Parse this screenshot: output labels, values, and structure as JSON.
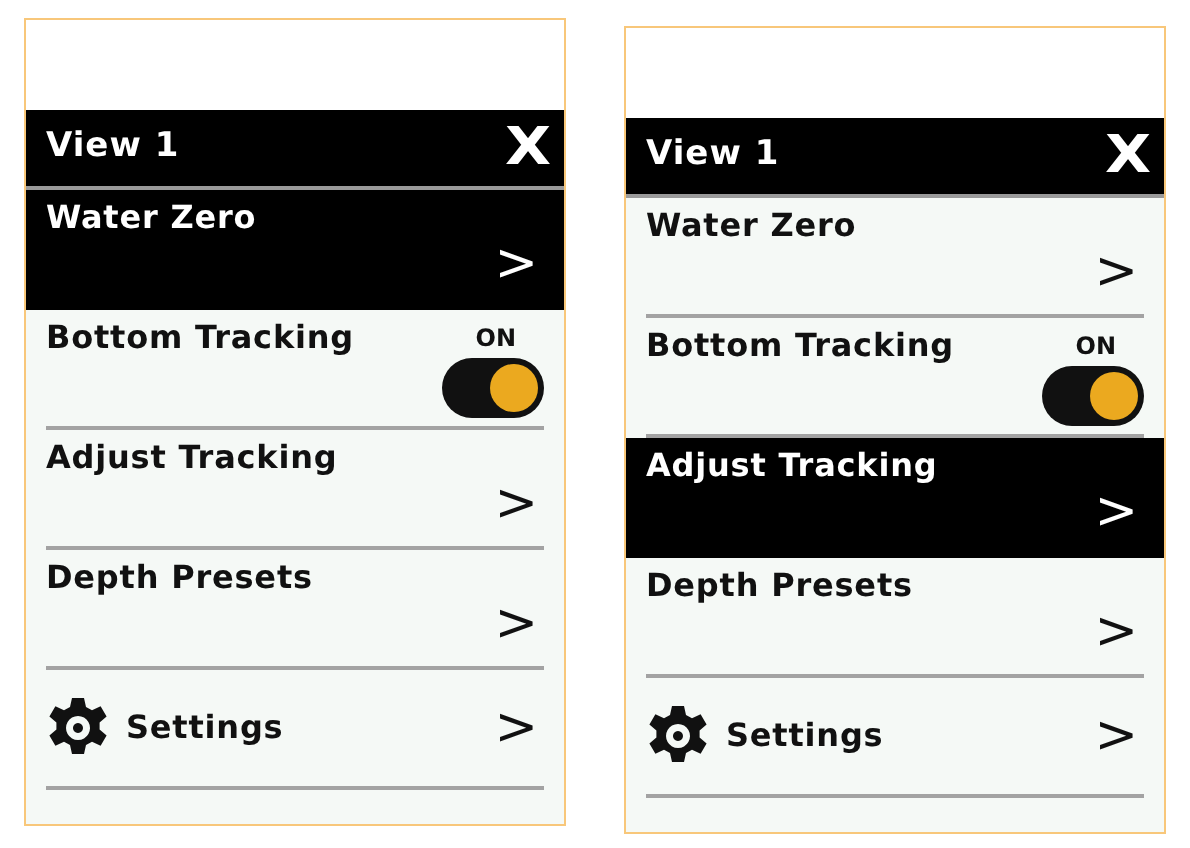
{
  "screens": [
    {
      "title": "View 1",
      "close": "X",
      "items": [
        {
          "kind": "nav",
          "label": "Water Zero",
          "arrow": ">",
          "selected": true
        },
        {
          "kind": "toggle",
          "label": "Bottom Tracking",
          "state_label": "ON",
          "on": true,
          "selected": false
        },
        {
          "kind": "nav",
          "label": "Adjust Tracking",
          "arrow": ">",
          "selected": false
        },
        {
          "kind": "nav",
          "label": "Depth Presets",
          "arrow": ">",
          "selected": false
        },
        {
          "kind": "icon-nav",
          "label": "Settings",
          "arrow": ">",
          "selected": false
        }
      ]
    },
    {
      "title": "View 1",
      "close": "X",
      "items": [
        {
          "kind": "nav",
          "label": "Water Zero",
          "arrow": ">",
          "selected": false
        },
        {
          "kind": "toggle",
          "label": "Bottom Tracking",
          "state_label": "ON",
          "on": true,
          "selected": false
        },
        {
          "kind": "nav",
          "label": "Adjust Tracking",
          "arrow": ">",
          "selected": true
        },
        {
          "kind": "nav",
          "label": "Depth Presets",
          "arrow": ">",
          "selected": false
        },
        {
          "kind": "icon-nav",
          "label": "Settings",
          "arrow": ">",
          "selected": false
        }
      ]
    }
  ]
}
